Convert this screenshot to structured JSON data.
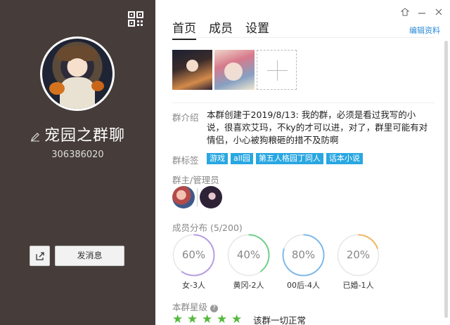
{
  "left": {
    "group_name": "宠园之群聊",
    "group_id": "306386020",
    "send_button": "发消息"
  },
  "right": {
    "tabs": [
      "首页",
      "成员",
      "设置"
    ],
    "edit_profile": "编辑资料",
    "intro_label": "群介绍",
    "intro_text": "本群创建于2019/8/13: 我的群，必须是看过我写的小说，很喜欢艾玛，不ky的才可以进，对了，群里可能有对情侣，小心被狗粮砸的措不及防啊",
    "tags_label": "群标签",
    "tags": [
      "游戏",
      "all园",
      "第五人格园丁同人",
      "话本小说"
    ],
    "admins_label": "群主/管理员",
    "members_label": "成员分布",
    "members_count": "(5/200)",
    "distribution": [
      {
        "value": "60%",
        "fraction": 0.6,
        "label": "女-3人",
        "color": "#b69ce0"
      },
      {
        "value": "40%",
        "fraction": 0.4,
        "label": "黄冈-2人",
        "color": "#6fd089"
      },
      {
        "value": "80%",
        "fraction": 0.8,
        "label": "00后-4人",
        "color": "#7fb8e8"
      },
      {
        "value": "20%",
        "fraction": 0.2,
        "label": "已婚-1人",
        "color": "#f0b560"
      }
    ],
    "level_label": "本群星级",
    "star_count": 5,
    "level_status": "该群一切正常"
  }
}
